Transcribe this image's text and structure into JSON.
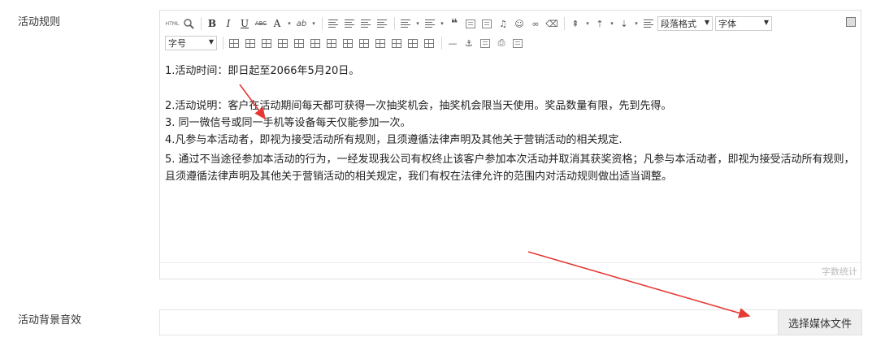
{
  "labels": {
    "rules": "活动规则",
    "bg_sound": "活动背景音效"
  },
  "toolbar": {
    "row1": [
      {
        "name": "html-source",
        "text": "HTML"
      },
      {
        "name": "search-replace",
        "text": ""
      },
      {
        "name": "bold",
        "text": "B"
      },
      {
        "name": "italic",
        "text": "I"
      },
      {
        "name": "underline",
        "text": "U"
      },
      {
        "name": "strikethrough",
        "text": "ABC"
      },
      {
        "name": "font-color",
        "text": "A"
      },
      {
        "name": "background-color",
        "text": "ab"
      }
    ],
    "paragraph_format": "段落格式",
    "font_family": "字体",
    "font_size": "字号"
  },
  "content": {
    "lines": [
      "1.活动时间：即日起至2066年5月20日。",
      "2.活动说明：客户在活动期间每天都可获得一次抽奖机会，抽奖机会限当天使用。奖品数量有限，先到先得。",
      "3. 同一微信号或同一手机等设备每天仅能参加一次。",
      "4.凡参与本活动者，即视为接受活动所有规则，且须遵循法律声明及其他关于营销活动的相关规定.",
      "5. 通过不当途径参加本活动的行为，一经发现我公司有权终止该客户参加本次活动并取消其获奖资格；凡参与本活动者，即视为接受活动所有规则，且须遵循法律声明及其他关于营销活动的相关规定，我们有权在法律允许的范围内对活动规则做出适当调整。"
    ]
  },
  "footer": {
    "word_count": "字数统计"
  },
  "media": {
    "value": "",
    "button_label": "选择媒体文件"
  },
  "colors": {
    "annotation_arrow": "#e53935"
  }
}
